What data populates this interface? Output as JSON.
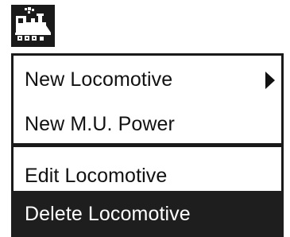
{
  "app": {
    "icon": "locomotive-icon"
  },
  "menu": {
    "items": [
      {
        "label": "New Locomotive",
        "has_submenu": true,
        "icon": "chevron-right-icon",
        "selected": false
      },
      {
        "label": "New M.U. Power",
        "has_submenu": false,
        "selected": false
      },
      {
        "label": "Edit Locomotive",
        "has_submenu": false,
        "selected": false
      },
      {
        "label": "Delete Locomotive",
        "has_submenu": false,
        "selected": true
      }
    ]
  },
  "colors": {
    "foreground": "#111111",
    "background": "#ffffff",
    "highlight": "#1e1e1e",
    "highlight_text": "#ffffff"
  }
}
